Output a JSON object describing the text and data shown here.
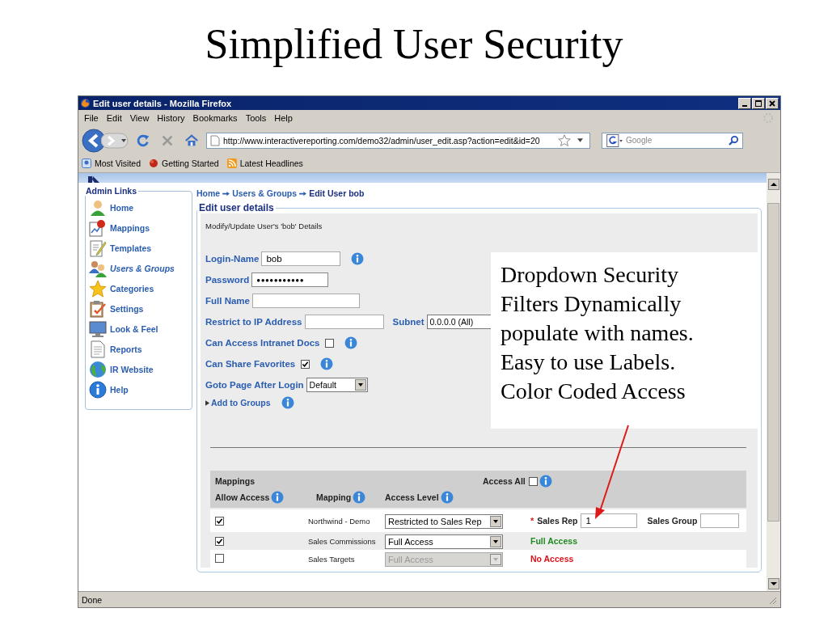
{
  "slide": {
    "title": "Simplified User Security"
  },
  "window": {
    "title": "Edit user details - Mozilla Firefox"
  },
  "menu": [
    "File",
    "Edit",
    "View",
    "History",
    "Bookmarks",
    "Tools",
    "Help"
  ],
  "address_bar": {
    "value": "http://www.interactivereporting.com/demo32/admin/user_edit.asp?action=edit&id=20"
  },
  "search": {
    "placeholder": "Google"
  },
  "bookmarks": [
    "Most Visited",
    "Getting Started",
    "Latest Headlines"
  ],
  "sidebar": {
    "title": "Admin Links",
    "items": [
      {
        "label": "Home",
        "selected": false
      },
      {
        "label": "Mappings",
        "selected": false
      },
      {
        "label": "Templates",
        "selected": false
      },
      {
        "label": "Users & Groups",
        "selected": true
      },
      {
        "label": "Categories",
        "selected": false
      },
      {
        "label": "Settings",
        "selected": false
      },
      {
        "label": "Look & Feel",
        "selected": false
      },
      {
        "label": "Reports",
        "selected": false
      },
      {
        "label": "IR Website",
        "selected": false
      },
      {
        "label": "Help",
        "selected": false
      }
    ]
  },
  "breadcrumb": [
    {
      "label": "Home",
      "kind": "link"
    },
    {
      "label": "Users & Groups",
      "kind": "link"
    },
    {
      "label": "Edit User bob",
      "kind": "current"
    }
  ],
  "form": {
    "title": "Edit user details",
    "subtitle": "Modify/Update User's 'bob' Details",
    "login_name": {
      "label": "Login-Name",
      "value": "bob"
    },
    "password": {
      "label": "Password",
      "value": "●●●●●●●●●●●"
    },
    "full_name": {
      "label": "Full Name"
    },
    "ip_address": {
      "label": "Restrict to IP Address"
    },
    "subnet": {
      "label": "Subnet",
      "value": "0.0.0.0 (All)"
    },
    "intranet_docs": {
      "label": "Can Access Intranet Docs",
      "checked": false
    },
    "share_favorites": {
      "label": "Can Share Favorites",
      "checked": true
    },
    "goto_page": {
      "label": "Goto Page After Login",
      "value": "Default"
    },
    "add_to_groups": {
      "label": "Add to Groups",
      "expanded": false
    }
  },
  "mappings": {
    "title": "Mappings",
    "access_all": {
      "label": "Access All",
      "checked": false
    },
    "columns": [
      "Allow Access",
      "Mapping",
      "Access Level"
    ],
    "rows": [
      {
        "kind": "filter",
        "checked": true,
        "mapping": "Northwind - Demo",
        "access_level": "Restricted to Sales Rep",
        "disabled": false,
        "required_mark": "*",
        "sales_rep_label": "Sales Rep",
        "sales_rep": "1",
        "sales_group_label": "Sales Group"
      },
      {
        "kind": "status",
        "checked": true,
        "mapping": "Sales Commissions",
        "access_level": "Full Access",
        "disabled": false,
        "status": "Full Access",
        "color": "#1f8a1f"
      },
      {
        "kind": "status",
        "checked": false,
        "mapping": "Sales Targets",
        "access_level": "Full Access",
        "disabled": true,
        "status": "No Access",
        "color": "#e0101a"
      }
    ]
  },
  "callout": {
    "text": "Dropdown Security\nFilters Dynamically\npopulate with names.\nEasy to use Labels.\nColor Coded Access"
  },
  "status_bar": {
    "text": "Done"
  }
}
